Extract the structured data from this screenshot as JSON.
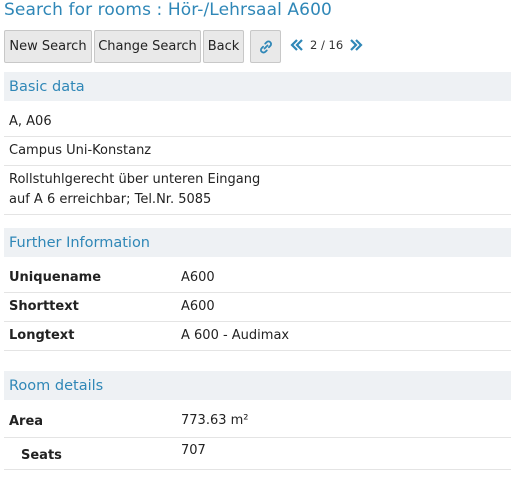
{
  "title": "Search for rooms : Hör-/Lehrsaal A600",
  "toolbar": {
    "new_search": "New Search",
    "change_search": "Change Search",
    "back": "Back",
    "link_icon": "link-icon",
    "pager": {
      "prev_icon": "double-chevron-left-icon",
      "text": "2 / 16",
      "next_icon": "double-chevron-right-icon"
    }
  },
  "basic_data": {
    "header": "Basic data",
    "lines": [
      "A, A06",
      "Campus Uni-Konstanz",
      "Rollstuhlgerecht über unteren Eingang",
      "auf A 6 erreichbar; Tel.Nr. 5085"
    ]
  },
  "further_information": {
    "header": "Further Information",
    "rows": [
      {
        "label": "Uniquename",
        "value": "A600"
      },
      {
        "label": "Shorttext",
        "value": "A600"
      },
      {
        "label": "Longtext",
        "value": "A 600 - Audimax"
      }
    ]
  },
  "room_details": {
    "header": "Room details",
    "rows": [
      {
        "label": "Area",
        "value": "773.63 m²"
      },
      {
        "label": "Seats",
        "value": "707"
      }
    ]
  },
  "colors": {
    "accent": "#2f87b7",
    "section_bg": "#eef1f4",
    "button_bg": "#e9e9e9"
  }
}
